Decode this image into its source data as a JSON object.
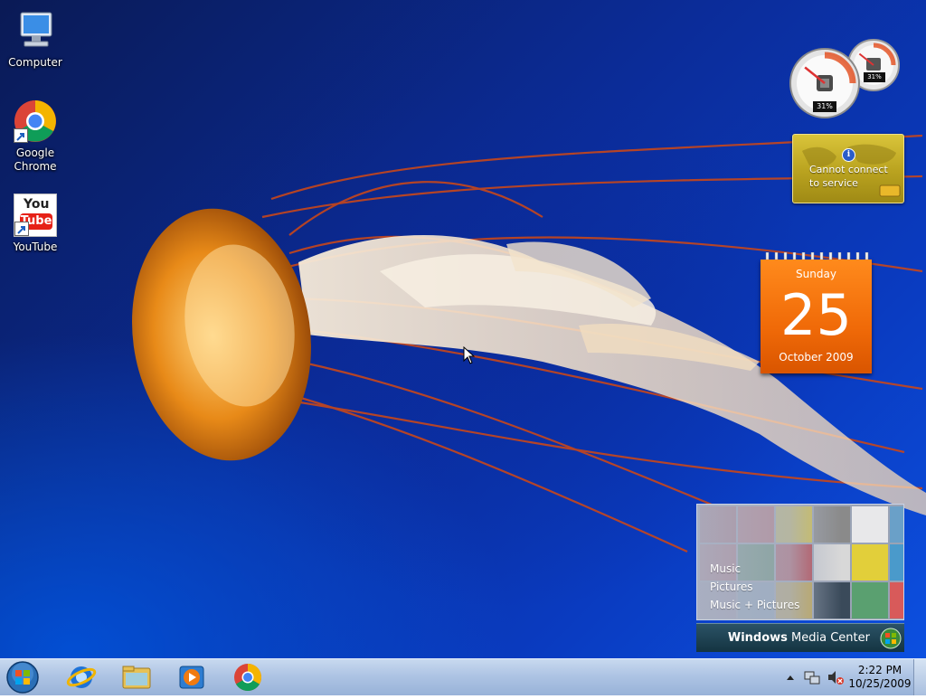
{
  "desktop": {
    "icons": [
      {
        "label": "Computer"
      },
      {
        "label": "Google\nChrome"
      },
      {
        "label": "YouTube"
      }
    ],
    "youtube_logo": {
      "top": "You",
      "bottom": "Tube"
    }
  },
  "gadgets": {
    "cpu_meter": {
      "cpu_readout": "31%",
      "memory_readout": "31%",
      "cpu_level": 0.31,
      "memory_level": 0.31
    },
    "weather": {
      "message": "Cannot connect to service"
    },
    "calendar": {
      "weekday": "Sunday",
      "day": "25",
      "month_year": "October 2009"
    },
    "media_center": {
      "menu": [
        "Music",
        "Pictures",
        "Music + Pictures"
      ],
      "brand_bold": "Windows",
      "brand_rest": " Media Center"
    }
  },
  "taskbar": {
    "pinned": [
      "internet-explorer",
      "windows-explorer",
      "windows-media-player",
      "google-chrome"
    ],
    "clock": {
      "time": "2:22 PM",
      "date": "10/25/2009"
    }
  },
  "colors": {
    "desktop_blue": "#0b2c99",
    "calendar_orange": "#f06a08",
    "weather_yellow": "#c4ae24",
    "taskbar": "#aec4e4"
  }
}
